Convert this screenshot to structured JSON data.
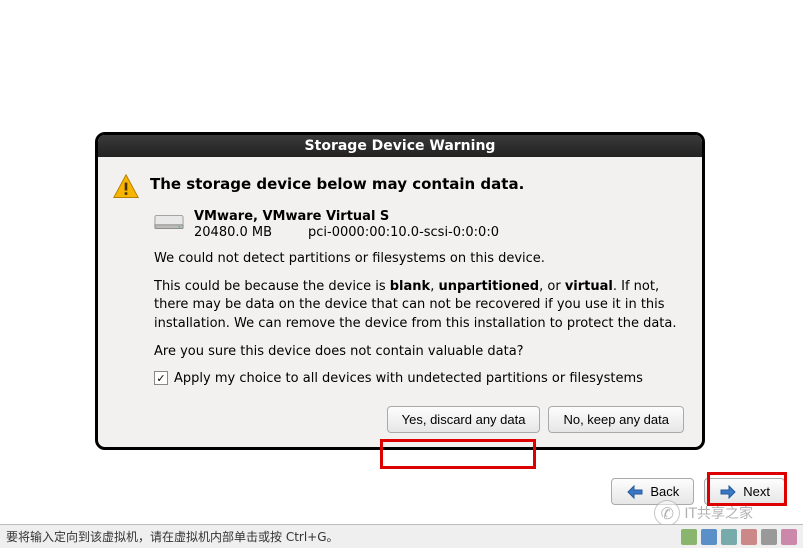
{
  "dialog": {
    "title": "Storage Device Warning",
    "warning_heading": "The storage device below may contain data.",
    "device": {
      "name": "VMware, VMware Virtual S",
      "size": "20480.0 MB",
      "path": "pci-0000:00:10.0-scsi-0:0:0:0"
    },
    "msg1": "We could not detect partitions or filesystems on this device.",
    "msg2_pre": "This could be because the device is ",
    "msg2_blank": "blank",
    "msg2_sep1": ", ",
    "msg2_unpart": "unpartitioned",
    "msg2_sep2": ", or ",
    "msg2_virtual": "virtual",
    "msg2_post": ". If not, there may be data on the device that can not be recovered if you use it in this installation. We can remove the device from this installation to protect the data.",
    "msg3": "Are you sure this device does not contain valuable data?",
    "checkbox_label": "Apply my choice to all devices with undetected partitions or filesystems",
    "checkbox_checked": "✓",
    "btn_yes": "Yes, discard any data",
    "btn_no": "No, keep any data"
  },
  "nav": {
    "back": "Back",
    "next": "Next"
  },
  "statusbar": {
    "text": "要将输入定向到该虚拟机，请在虚拟机内部单击或按 Ctrl+G。"
  },
  "watermark": {
    "text": "IT共享之家"
  }
}
